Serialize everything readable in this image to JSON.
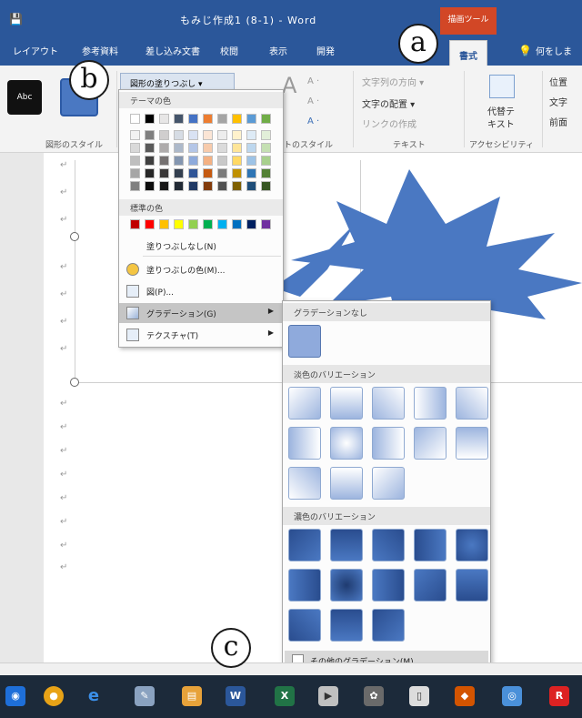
{
  "titlebar": {
    "title": "もみじ作成1 (8-1) - Word",
    "drawing_tools": "描画ツール",
    "qat": "💾"
  },
  "tabs": [
    {
      "label": "レイアウト"
    },
    {
      "label": "参考資料"
    },
    {
      "label": "差し込み文書"
    },
    {
      "label": "校閲"
    },
    {
      "label": "表示"
    },
    {
      "label": "開発"
    },
    {
      "label": "書式"
    },
    {
      "label": "何をしま"
    }
  ],
  "ribbon": {
    "abc_sample": "Abc",
    "shape_fill_button": "図形の塗りつぶし ▾",
    "shape_styles_label": "図形のスタイル",
    "wordart_styles_label": "トのスタイル",
    "text_direction": "文字列の方向 ▾",
    "align_text": "文字の配置 ▾",
    "create_link": "リンクの作成",
    "text_group_label": "テキスト",
    "alt_text_line1": "代替テ",
    "alt_text_line2": "キスト",
    "accessibility_label": "アクセシビリティ",
    "position_label": "位置",
    "wrap_label": "文字",
    "bring_label": "前面"
  },
  "fill_menu": {
    "theme_colors_header": "テーマの色",
    "theme_colors": [
      "#ffffff",
      "#000000",
      "#e7e6e6",
      "#44546a",
      "#4472c4",
      "#ed7d31",
      "#a5a5a5",
      "#ffc000",
      "#5b9bd5",
      "#70ad47"
    ],
    "theme_shades": [
      [
        "#f2f2f2",
        "#d9d9d9",
        "#bfbfbf",
        "#a6a6a6",
        "#808080"
      ],
      [
        "#7f7f7f",
        "#595959",
        "#3f3f3f",
        "#262626",
        "#0d0d0d"
      ],
      [
        "#d0cece",
        "#aeabab",
        "#757171",
        "#3a3838",
        "#171616"
      ],
      [
        "#d6dce4",
        "#adb9ca",
        "#8496b0",
        "#333f4f",
        "#222a35"
      ],
      [
        "#d9e2f3",
        "#b4c6e7",
        "#8eaadb",
        "#2f5496",
        "#1f3864"
      ],
      [
        "#fbe5d5",
        "#f7cbac",
        "#f4b183",
        "#c55a11",
        "#833c0b"
      ],
      [
        "#ededed",
        "#dbdbdb",
        "#c9c9c9",
        "#7b7b7b",
        "#525252"
      ],
      [
        "#fff2cc",
        "#fee599",
        "#ffd965",
        "#bf9000",
        "#7f6000"
      ],
      [
        "#deebf6",
        "#bdd7ee",
        "#9dc3e6",
        "#2e75b5",
        "#1f4e79"
      ],
      [
        "#e2efd9",
        "#c5e0b3",
        "#a8d08d",
        "#538135",
        "#375623"
      ]
    ],
    "standard_colors_header": "標準の色",
    "standard_colors": [
      "#c00000",
      "#ff0000",
      "#ffc000",
      "#ffff00",
      "#92d050",
      "#00b050",
      "#00b0f0",
      "#0070c0",
      "#002060",
      "#7030a0"
    ],
    "no_fill": "塗りつぶしなし(N)",
    "more_fill_colors": "塗りつぶしの色(M)...",
    "picture": "図(P)...",
    "gradient": "グラデーション(G)",
    "texture": "テクスチャ(T)"
  },
  "gradient_menu": {
    "no_gradient_header": "グラデーションなし",
    "light_variations_header": "淡色のバリエーション",
    "dark_variations_header": "濃色のバリエーション",
    "more_gradients": "その他のグラデーション(M)..."
  },
  "callouts": {
    "a": "a",
    "b": "b",
    "c": "c"
  },
  "document": {
    "para_mark": "↵"
  },
  "colors": {
    "accent": "#2b579a",
    "leaf": "#4a78c2"
  }
}
